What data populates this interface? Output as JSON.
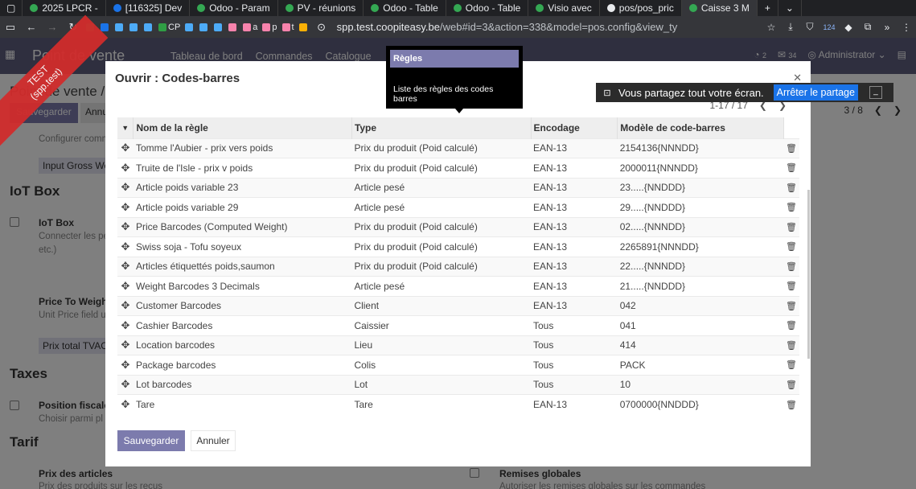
{
  "browser": {
    "tabs": [
      {
        "label": "2025 LPCR - ",
        "color": "#34a853"
      },
      {
        "label": "[116325] Dev",
        "color": "#1a73e8"
      },
      {
        "label": "Odoo - Param",
        "color": "#34a853"
      },
      {
        "label": "PV - réunions",
        "color": "#34a853"
      },
      {
        "label": "Odoo - Table",
        "color": "#34a853"
      },
      {
        "label": "Odoo - Table",
        "color": "#34a853"
      },
      {
        "label": "Visio avec",
        "color": "#34a853"
      },
      {
        "label": "pos/pos_pric",
        "color": "#e8eaed"
      },
      {
        "label": "Caisse 3 M",
        "color": "#34a853"
      }
    ],
    "bookmarks": [
      {
        "label": "",
        "color": "#2f9e44"
      },
      {
        "label": "",
        "color": "#1a73e8"
      },
      {
        "label": "",
        "color": "#4dabf7"
      },
      {
        "label": "",
        "color": "#4dabf7"
      },
      {
        "label": "",
        "color": "#4dabf7"
      },
      {
        "label": "CP",
        "color": "#2f9e44"
      },
      {
        "label": "",
        "color": "#4dabf7"
      },
      {
        "label": "",
        "color": "#4dabf7"
      },
      {
        "label": "",
        "color": "#4dabf7"
      },
      {
        "label": "",
        "color": "#f783ac"
      },
      {
        "label": "a",
        "color": "#f783ac"
      },
      {
        "label": "p",
        "color": "#f783ac"
      },
      {
        "label": "t",
        "color": "#f783ac"
      },
      {
        "label": "",
        "color": "#fab005"
      }
    ],
    "url_domain": "spp.test.coopiteasy.be",
    "url_path": "/web#id=3&action=338&model=pos.config&view_ty",
    "ext_badge": "124"
  },
  "odoo": {
    "app_title": "Point de vente",
    "menu": [
      "Tableau de bord",
      "Commandes",
      "Catalogue"
    ],
    "activity_count": "2",
    "message_count": "34",
    "user": "Administrator"
  },
  "background": {
    "breadcrumb": "Point de vente / C",
    "save": "Sauvegarder",
    "cancel": "Annu",
    "pager": "3 / 8",
    "ribbon_line1": "TEST",
    "ribbon_line2": "(spp.test)",
    "configurer": "Configurer comm",
    "input_chip": "Input Gross Wei",
    "iot_section": "IoT Box",
    "iot_label": "IoT Box",
    "iot_sub1": "Connecter les pé",
    "iot_sub2": "etc.)",
    "price_label": "Price To Weigh",
    "price_sub": "Unit Price field u",
    "prix_chip": "Prix total TVAC",
    "taxes_section": "Taxes",
    "position_label": "Position fiscale",
    "position_sub": "Choisir parmi pl",
    "tarif_section": "Tarif",
    "prix_articles": "Prix des articles",
    "prix_articles_sub": "Prix des produits sur les reçus",
    "remises": "Remises globales",
    "remises_sub": "Autoriser les remises globales sur les commandes"
  },
  "modal": {
    "title": "Ouvrir : Codes-barres",
    "pager": "1-17 / 17",
    "columns": [
      "Nom de la règle",
      "Type",
      "Encodage",
      "Modèle de code-barres"
    ],
    "rows": [
      {
        "name": "Tomme l'Aubier - prix vers poids",
        "type": "Prix du produit (Poid calculé)",
        "encoding": "EAN-13",
        "pattern": "2154136{NNNDD}"
      },
      {
        "name": "Truite de l'Isle - prix v poids",
        "type": "Prix du produit (Poid calculé)",
        "encoding": "EAN-13",
        "pattern": "2000011{NNNDD}"
      },
      {
        "name": "Article poids variable 23",
        "type": "Article pesé",
        "encoding": "EAN-13",
        "pattern": "23.....{NNDDD}"
      },
      {
        "name": "Article poids variable 29",
        "type": "Article pesé",
        "encoding": "EAN-13",
        "pattern": "29.....{NNDDD}"
      },
      {
        "name": "Price Barcodes (Computed Weight)",
        "type": "Prix du produit (Poid calculé)",
        "encoding": "EAN-13",
        "pattern": "02.....{NNNDD}"
      },
      {
        "name": "Swiss soja - Tofu soyeux",
        "type": "Prix du produit (Poid calculé)",
        "encoding": "EAN-13",
        "pattern": "2265891{NNNDD}"
      },
      {
        "name": "Articles étiquettés poids,saumon",
        "type": "Prix du produit (Poid calculé)",
        "encoding": "EAN-13",
        "pattern": "22.....{NNNDD}"
      },
      {
        "name": "Weight Barcodes 3 Decimals",
        "type": "Article pesé",
        "encoding": "EAN-13",
        "pattern": "21.....{NNDDD}"
      },
      {
        "name": "Customer Barcodes",
        "type": "Client",
        "encoding": "EAN-13",
        "pattern": "042"
      },
      {
        "name": "Cashier Barcodes",
        "type": "Caissier",
        "encoding": "Tous",
        "pattern": "041"
      },
      {
        "name": "Location barcodes",
        "type": "Lieu",
        "encoding": "Tous",
        "pattern": "414"
      },
      {
        "name": "Package barcodes",
        "type": "Colis",
        "encoding": "Tous",
        "pattern": "PACK"
      },
      {
        "name": "Lot barcodes",
        "type": "Lot",
        "encoding": "Tous",
        "pattern": "10"
      },
      {
        "name": "Tare",
        "type": "Tare",
        "encoding": "EAN-13",
        "pattern": "0700000{NNDDD}"
      }
    ],
    "save": "Sauvegarder",
    "cancel": "Annuler"
  },
  "tooltip": {
    "title": "Règles",
    "text": "Liste des règles des codes barres"
  },
  "share": {
    "text": "Vous partagez tout votre écran.",
    "stop": "Arrêter le partage"
  },
  "colors": {
    "accent": "#7c7bad",
    "navbar": "#5e5e7e",
    "ribbon": "#d12c2c",
    "share_button": "#1a73e8"
  }
}
